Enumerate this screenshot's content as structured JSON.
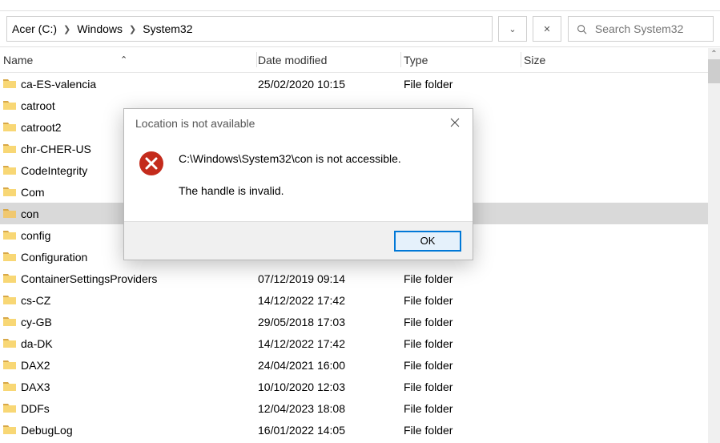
{
  "breadcrumb": {
    "c1": "Acer (C:)",
    "c2": "Windows",
    "c3": "System32"
  },
  "search": {
    "placeholder": "Search System32"
  },
  "headers": {
    "name": "Name",
    "date": "Date modified",
    "type": "Type",
    "size": "Size"
  },
  "rows": [
    {
      "name": "ca-ES-valencia",
      "date": "25/02/2020 10:15",
      "type": "File folder"
    },
    {
      "name": "catroot",
      "date": "",
      "type": ""
    },
    {
      "name": "catroot2",
      "date": "",
      "type": ""
    },
    {
      "name": "chr-CHER-US",
      "date": "",
      "type": ""
    },
    {
      "name": "CodeIntegrity",
      "date": "",
      "type": ""
    },
    {
      "name": "Com",
      "date": "",
      "type": ""
    },
    {
      "name": "con",
      "date": "",
      "type": "",
      "selected": true
    },
    {
      "name": "config",
      "date": "",
      "type": ""
    },
    {
      "name": "Configuration",
      "date": "",
      "type": ""
    },
    {
      "name": "ContainerSettingsProviders",
      "date": "07/12/2019 09:14",
      "type": "File folder"
    },
    {
      "name": "cs-CZ",
      "date": "14/12/2022 17:42",
      "type": "File folder"
    },
    {
      "name": "cy-GB",
      "date": "29/05/2018 17:03",
      "type": "File folder"
    },
    {
      "name": "da-DK",
      "date": "14/12/2022 17:42",
      "type": "File folder"
    },
    {
      "name": "DAX2",
      "date": "24/04/2021 16:00",
      "type": "File folder"
    },
    {
      "name": "DAX3",
      "date": "10/10/2020 12:03",
      "type": "File folder"
    },
    {
      "name": "DDFs",
      "date": "12/04/2023 18:08",
      "type": "File folder"
    },
    {
      "name": "DebugLog",
      "date": "16/01/2022 14:05",
      "type": "File folder"
    }
  ],
  "dialog": {
    "title": "Location is not available",
    "line1": "C:\\Windows\\System32\\con is not accessible.",
    "line2": "The handle is invalid.",
    "ok": "OK"
  },
  "colors": {
    "error": "#c42b1c",
    "accent": "#0078d7",
    "folder_tab": "#d8a848",
    "folder_body": "#f8d775"
  }
}
